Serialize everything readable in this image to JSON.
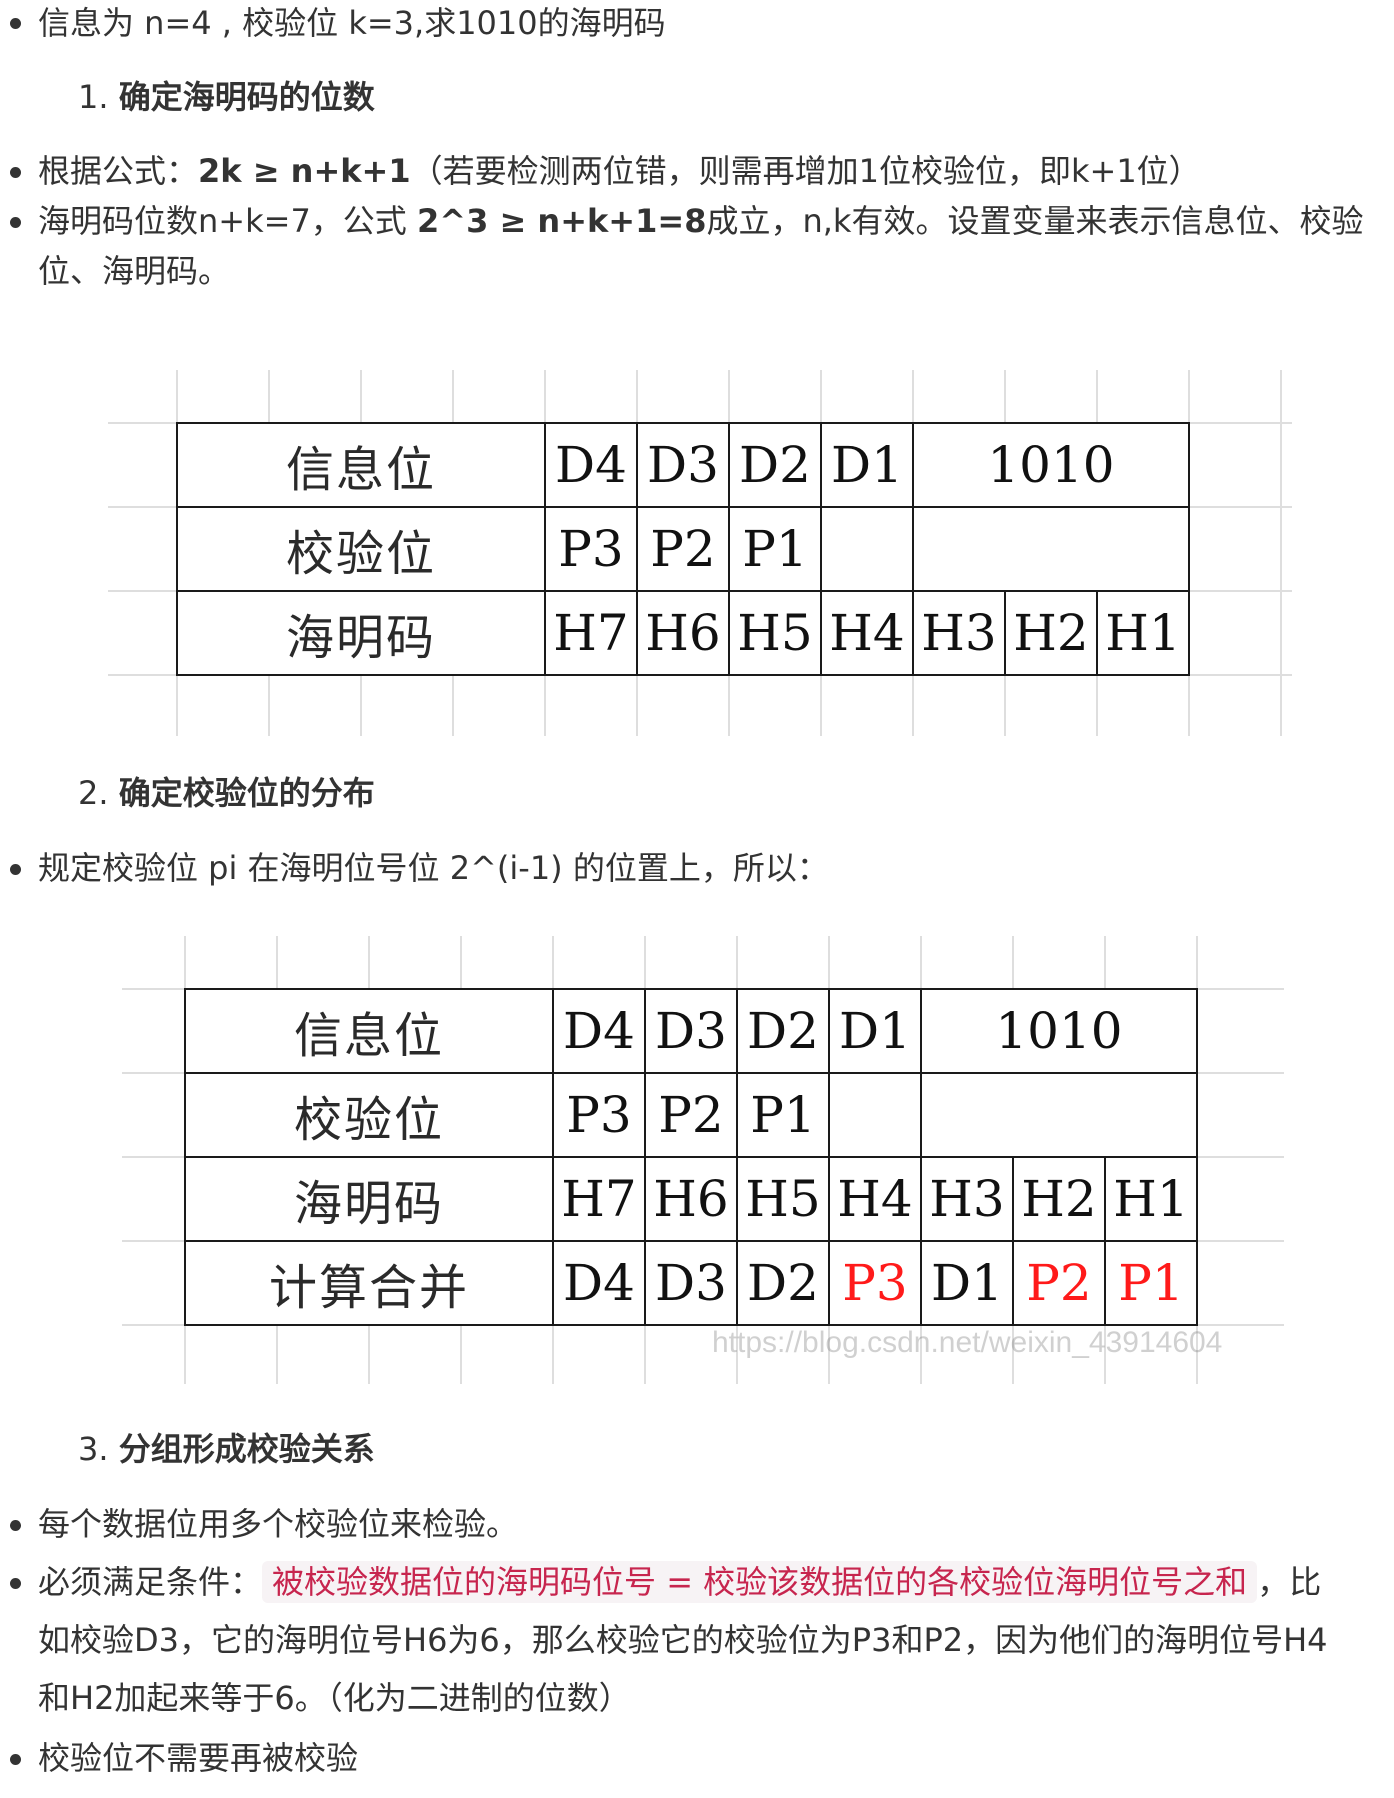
{
  "intro": {
    "line": "信息为 n=4 , 校验位 k=3,求1010的海明码"
  },
  "section1": {
    "num": "1.",
    "title": "确定海明码的位数",
    "bullet1": {
      "prefix": "根据公式：",
      "formula": "2k ≥ n+k+1",
      "suffix": "（若要检测两位错，则需再增加1位校验位，即k+1位）"
    },
    "bullet2": {
      "prefix": "海明码位数n+k=7，公式 ",
      "formula": "2^3 ≥ n+k+1=8",
      "suffix": "成立，n,k有效。设置变量来表示信息位、校验",
      "line2": "位、海明码。"
    }
  },
  "table1": {
    "row1": {
      "label": "信息位",
      "cells": [
        "D4",
        "D3",
        "D2",
        "D1"
      ],
      "value": "1010"
    },
    "row2": {
      "label": "校验位",
      "cells": [
        "P3",
        "P2",
        "P1"
      ]
    },
    "row3": {
      "label": "海明码",
      "cells": [
        "H7",
        "H6",
        "H5",
        "H4",
        "H3",
        "H2",
        "H1"
      ]
    }
  },
  "section2": {
    "num": "2.",
    "title": "确定校验位的分布",
    "bullet1": "规定校验位 pi 在海明位号位 2^(i-1) 的位置上，所以："
  },
  "table2": {
    "row1": {
      "label": "信息位",
      "cells": [
        "D4",
        "D3",
        "D2",
        "D1"
      ],
      "value": "1010"
    },
    "row2": {
      "label": "校验位",
      "cells": [
        "P3",
        "P2",
        "P1"
      ]
    },
    "row3": {
      "label": "海明码",
      "cells": [
        "H7",
        "H6",
        "H5",
        "H4",
        "H3",
        "H2",
        "H1"
      ]
    },
    "row4": {
      "label": "计算合并",
      "cells": [
        "D4",
        "D3",
        "D2",
        "P3",
        "D1",
        "P2",
        "P1"
      ]
    },
    "watermark": "https://blog.csdn.net/weixin_43914604",
    "highlight_color": "#ff1a1a"
  },
  "section3": {
    "num": "3.",
    "title": "分组形成校验关系",
    "bullet1": "每个数据位用多个校验位来检验。",
    "bullet2": {
      "prefix": "必须满足条件：",
      "code": "被校验数据位的海明码位号 = 校验该数据位的各校验位海明位号之和",
      "suffix": "，比",
      "line2": "如校验D3，它的海明位号H6为6，那么校验它的校验位为P3和P2，因为他们的海明位号H4",
      "line3": "和H2加起来等于6。（化为二进制的位数）"
    },
    "bullet3": "校验位不需要再被校验"
  }
}
